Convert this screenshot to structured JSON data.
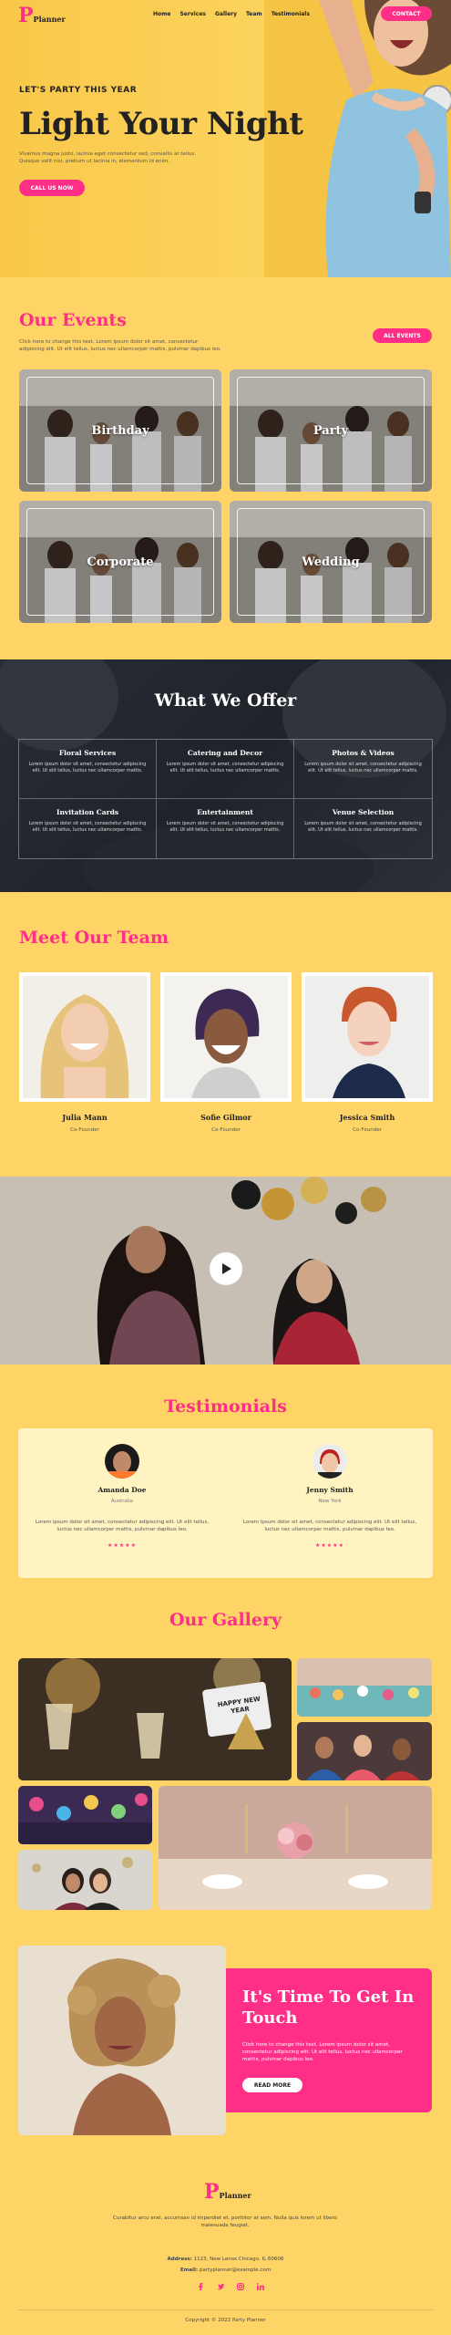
{
  "brand": {
    "letter": "P",
    "word": "Planner"
  },
  "nav": {
    "items": [
      "Home",
      "Services",
      "Gallery",
      "Team",
      "Testimonials"
    ],
    "contact": "CONTACT"
  },
  "hero": {
    "kicker": "LET'S PARTY THIS YEAR",
    "title": "Light Your Night",
    "text": "Vivamus magna justo, lacinia eget consectetur sed, convallis at tellus. Quisque velit nisi, pretium ut lacinia in, elementum id enim.",
    "cta": "CALL US NOW"
  },
  "events": {
    "title": "Our Events",
    "text": "Click here to change this text. Lorem ipsum dolor sit amet, consectetur adipiscing elit. Ut elit tellus, luctus nec ullamcorper mattis, pulvinar dapibus leo.",
    "button": "ALL EVENTS",
    "cards": [
      "Birthday",
      "Party",
      "Corporate",
      "Wedding"
    ]
  },
  "offer": {
    "title": "What We Offer",
    "items": [
      {
        "title": "Floral Services",
        "text": "Lorem ipsum dolor sit amet, consectetur adipiscing elit. Ut elit tellus, luctus nec ullamcorper mattis."
      },
      {
        "title": "Catering and Decor",
        "text": "Lorem ipsum dolor sit amet, consectetur adipiscing elit. Ut elit tellus, luctus nec ullamcorper mattis."
      },
      {
        "title": "Photos & Videos",
        "text": "Lorem ipsum dolor sit amet, consectetur adipiscing elit. Ut elit tellus, luctus nec ullamcorper mattis."
      },
      {
        "title": "Invitation Cards",
        "text": "Lorem ipsum dolor sit amet, consectetur adipiscing elit. Ut elit tellus, luctus nec ullamcorper mattis."
      },
      {
        "title": "Entertainment",
        "text": "Lorem ipsum dolor sit amet, consectetur adipiscing elit. Ut elit tellus, luctus nec ullamcorper mattis."
      },
      {
        "title": "Venue Selection",
        "text": "Lorem ipsum dolor sit amet, consectetur adipiscing elit. Ut elit tellus, luctus nec ullamcorper mattis."
      }
    ]
  },
  "team": {
    "title": "Meet Our Team",
    "members": [
      {
        "name": "Julia Mann",
        "role": "Co-Founder"
      },
      {
        "name": "Sofie Gilmor",
        "role": "Co-Founder"
      },
      {
        "name": "Jessica Smith",
        "role": "Co-Founder"
      }
    ]
  },
  "testimonials": {
    "title": "Testimonials",
    "items": [
      {
        "name": "Amanda Doe",
        "location": "Australia",
        "quote": "Lorem ipsum dolor sit amet, consectetur adipiscing elit. Ut elit tellus, luctus nec ullamcorper mattis, pulvinar dapibus leo.",
        "stars": "★★★★★"
      },
      {
        "name": "Jenny Smith",
        "location": "New York",
        "quote": "Lorem ipsum dolor sit amet, consectetur adipiscing elit. Ut elit tellus, luctus nec ullamcorper mattis, pulvinar dapibus leo.",
        "stars": "★★★★★"
      }
    ]
  },
  "gallery": {
    "title": "Our Gallery",
    "sign": "HAPPY NEW YEAR"
  },
  "touch": {
    "title": "It's Time To Get In Touch",
    "text": "Click here to change this text. Lorem ipsum dolor sit amet, consectetur adipiscing elit. Ut elit tellus, luctus nec ullamcorper mattis, pulvinar dapibus leo.",
    "button": "READ MORE"
  },
  "footer": {
    "text": "Curabitur arcu erat, accumsan id imperdiet et, porttitor at sem. Nulla quis lorem ut libero malesuada feugiat.",
    "address_label": "Address:",
    "address": "1123, New Lenox Chicago, IL 60606",
    "email_label": "Email:",
    "email": "partyplanner@example.com",
    "copyright": "Copyright © 2022 Party Planner"
  },
  "icons": [
    "play-icon",
    "facebook-icon",
    "twitter-icon",
    "instagram-icon",
    "linkedin-icon"
  ],
  "colors": {
    "accent": "#ff2f87",
    "background": "#ffd466",
    "dark": "#2f323a"
  }
}
